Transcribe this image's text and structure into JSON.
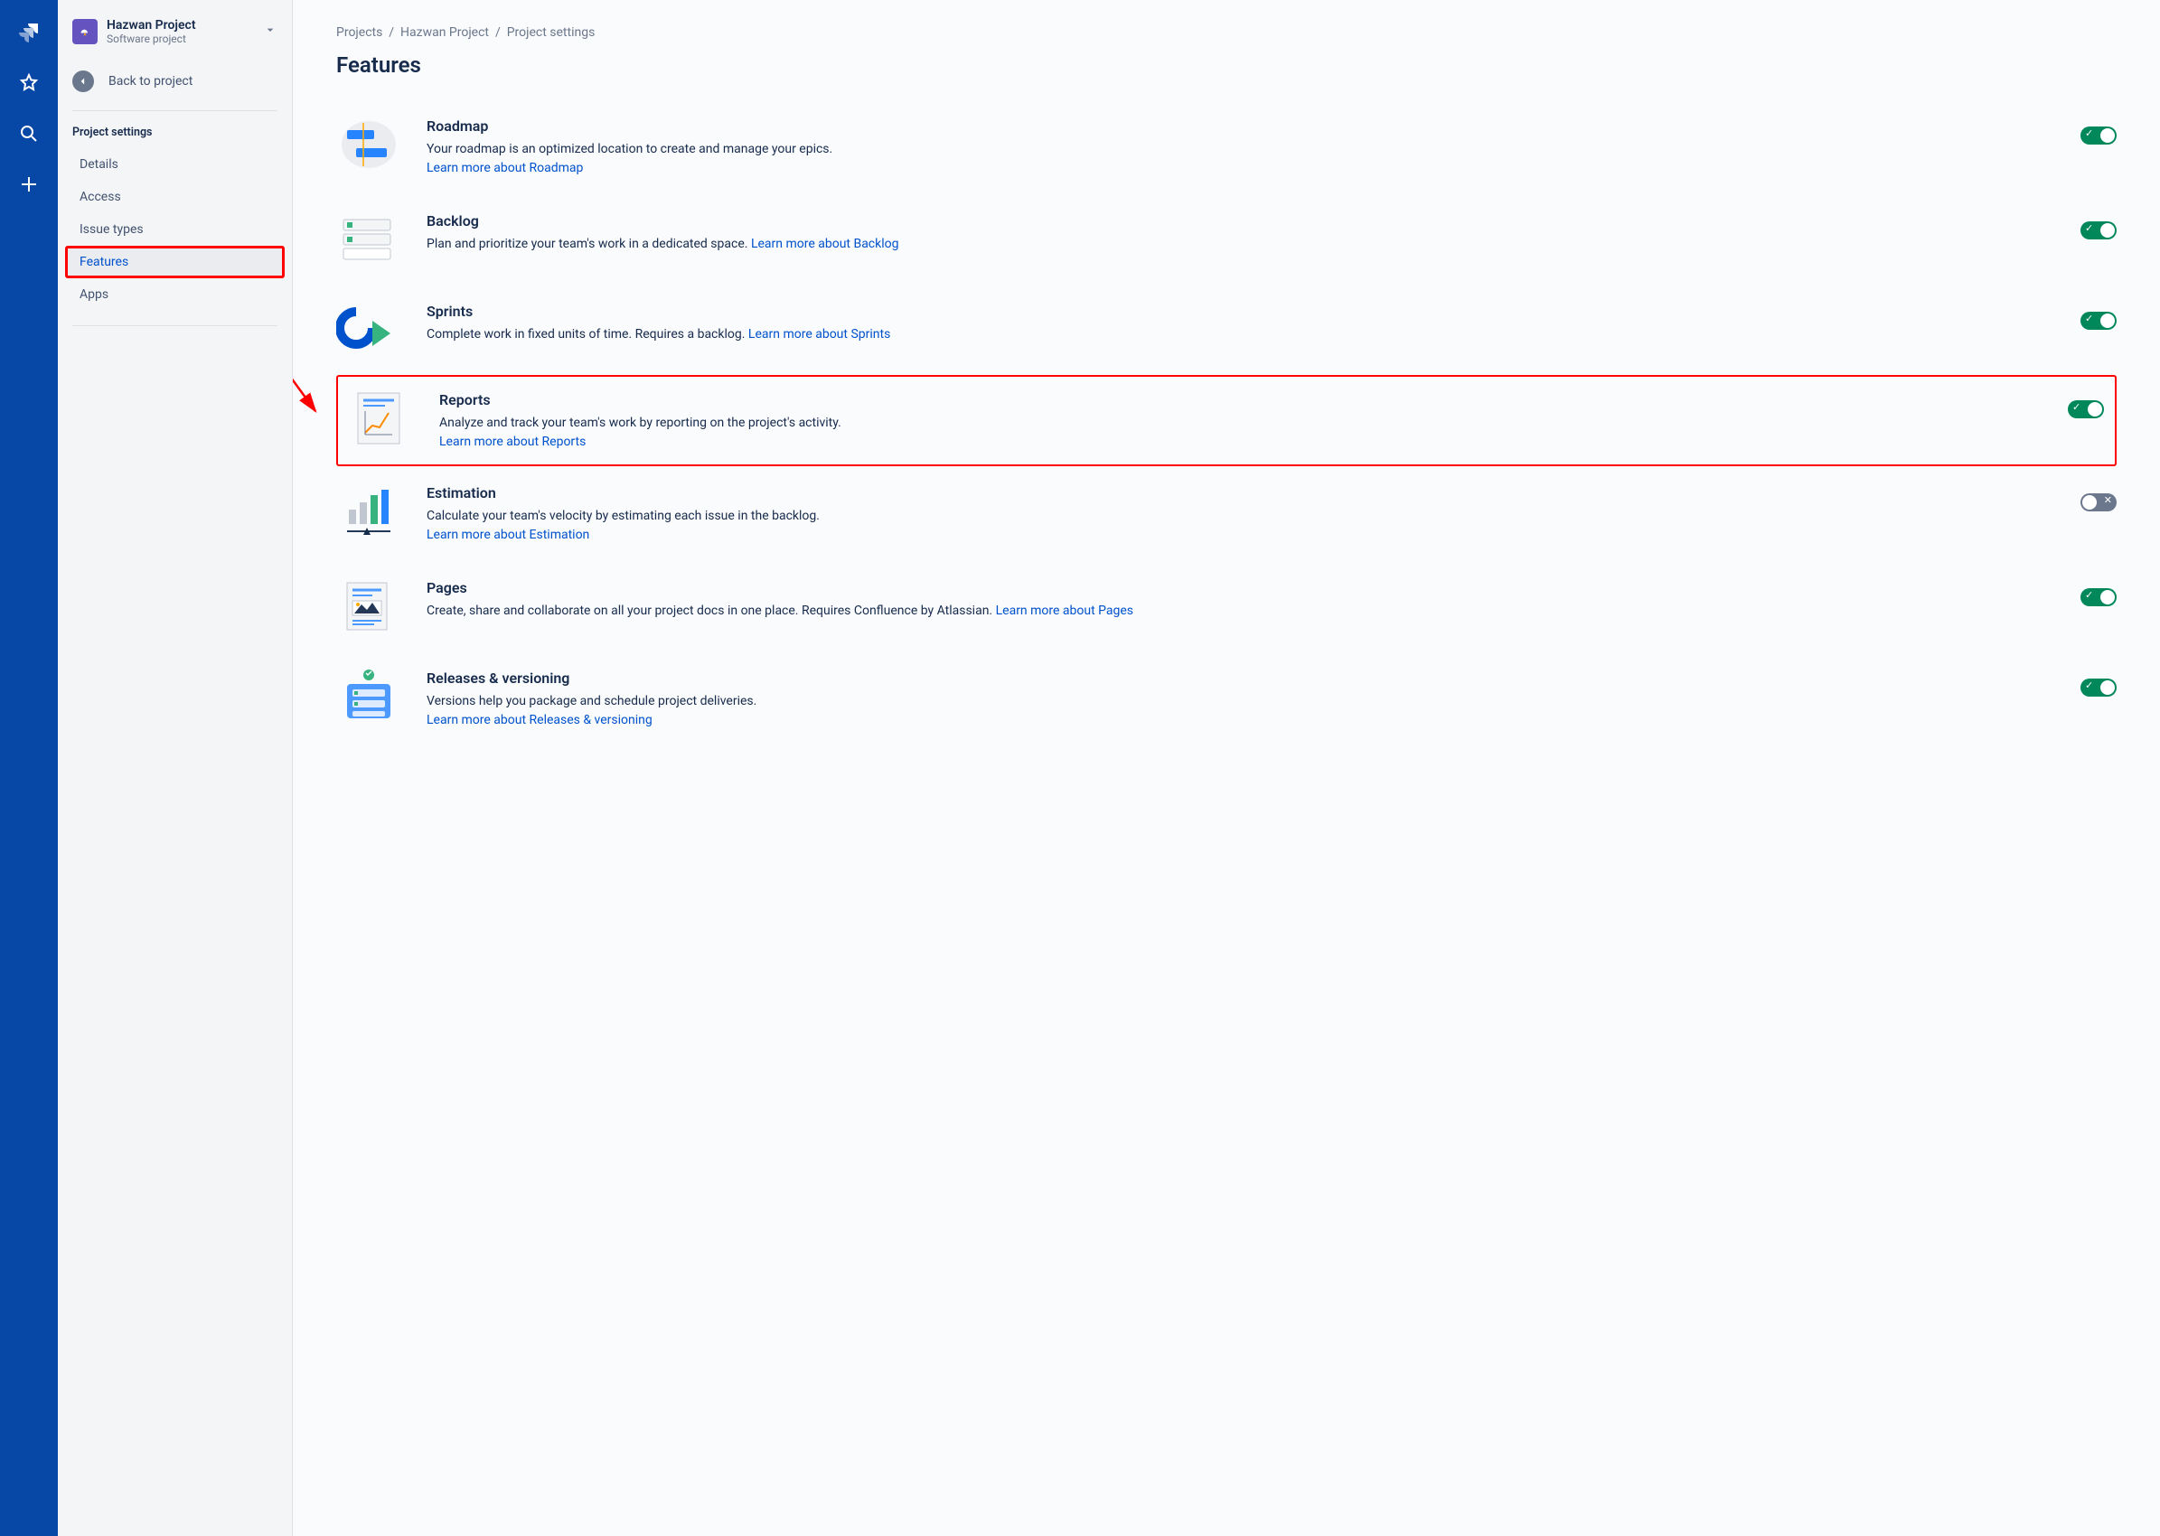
{
  "project": {
    "name": "Hazwan Project",
    "subtitle": "Software project"
  },
  "sidebar": {
    "back": "Back to project",
    "section": "Project settings",
    "items": [
      {
        "label": "Details"
      },
      {
        "label": "Access"
      },
      {
        "label": "Issue types"
      },
      {
        "label": "Features"
      },
      {
        "label": "Apps"
      }
    ]
  },
  "breadcrumbs": [
    "Projects",
    "Hazwan Project",
    "Project settings"
  ],
  "pageTitle": "Features",
  "features": [
    {
      "title": "Roadmap",
      "desc": "Your roadmap is an optimized location to create and manage your epics.",
      "link": "Learn more about Roadmap",
      "enabled": true
    },
    {
      "title": "Backlog",
      "desc": "Plan and prioritize your team's work in a dedicated space.",
      "link": "Learn more about Backlog",
      "enabled": true
    },
    {
      "title": "Sprints",
      "desc": "Complete work in fixed units of time. Requires a backlog.",
      "link": "Learn more about Sprints",
      "enabled": true
    },
    {
      "title": "Reports",
      "desc": "Analyze and track your team's work by reporting on the project's activity.",
      "link": "Learn more about Reports",
      "enabled": true
    },
    {
      "title": "Estimation",
      "desc": "Calculate your team's velocity by estimating each issue in the backlog.",
      "link": "Learn more about Estimation",
      "enabled": false
    },
    {
      "title": "Pages",
      "desc": "Create, share and collaborate on all your project docs in one place. Requires Confluence by Atlassian.",
      "link": "Learn more about Pages",
      "enabled": true
    },
    {
      "title": "Releases & versioning",
      "desc": "Versions help you package and schedule project deliveries.",
      "link": "Learn more about Releases & versioning",
      "enabled": true
    }
  ]
}
